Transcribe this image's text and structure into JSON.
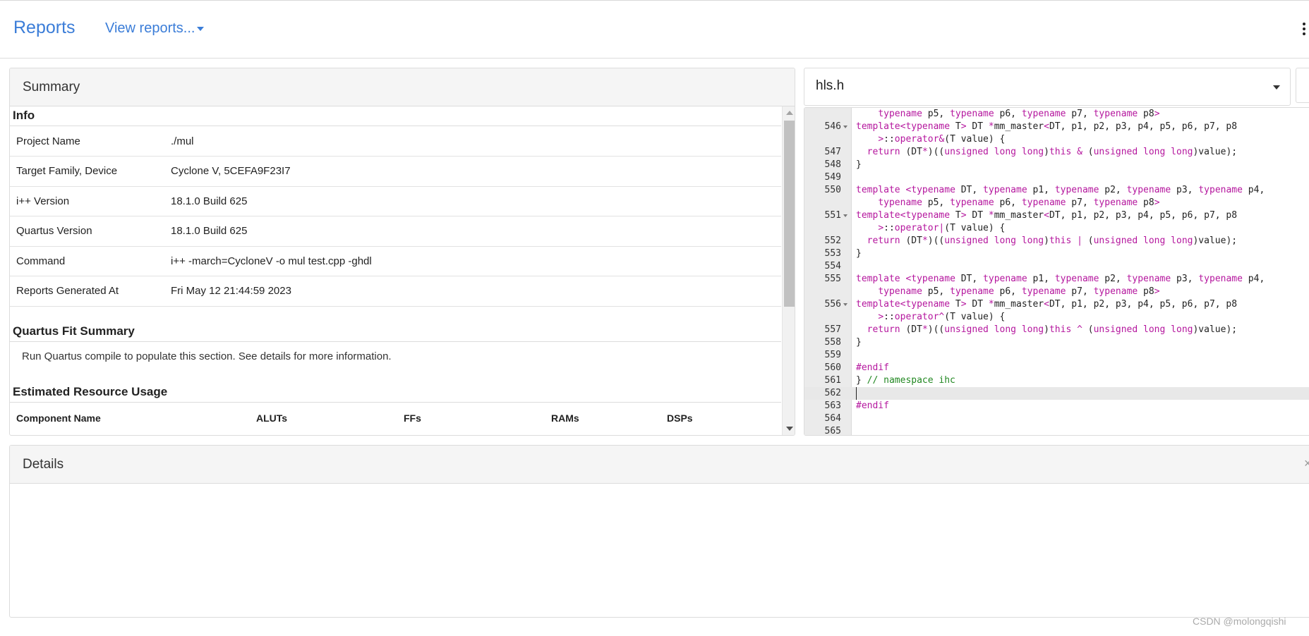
{
  "header": {
    "brand": "Reports",
    "view_reports": "View reports..."
  },
  "summary": {
    "title": "Summary",
    "info_title": "Info",
    "info_rows": [
      {
        "key": "Project Name",
        "value": "./mul"
      },
      {
        "key": "Target Family, Device",
        "value": "Cyclone V, 5CEFA9F23I7"
      },
      {
        "key": "i++ Version",
        "value": "18.1.0 Build 625"
      },
      {
        "key": "Quartus Version",
        "value": "18.1.0 Build 625"
      },
      {
        "key": "Command",
        "value": "i++ -march=CycloneV -o mul test.cpp -ghdl"
      },
      {
        "key": "Reports Generated At",
        "value": "Fri May 12 21:44:59 2023"
      }
    ],
    "fit_title": "Quartus Fit Summary",
    "fit_note": "Run Quartus compile to populate this section. See details for more information.",
    "resource_title": "Estimated Resource Usage",
    "resource_columns": [
      "Component Name",
      "ALUTs",
      "FFs",
      "RAMs",
      "DSPs"
    ]
  },
  "code": {
    "file": "hls.h",
    "lines": [
      {
        "num": "",
        "fold": false,
        "segs": [
          {
            "t": "    "
          },
          {
            "t": "typename",
            "k": 1
          },
          {
            "t": " p5, "
          },
          {
            "t": "typename",
            "k": 1
          },
          {
            "t": " p6, "
          },
          {
            "t": "typename",
            "k": 1
          },
          {
            "t": " p7, "
          },
          {
            "t": "typename",
            "k": 1
          },
          {
            "t": " p8"
          },
          {
            "t": ">",
            "k": 1
          }
        ]
      },
      {
        "num": "546",
        "fold": true,
        "segs": [
          {
            "t": "template<typename",
            "k": 1
          },
          {
            "t": " T"
          },
          {
            "t": ">",
            "k": 1
          },
          {
            "t": " DT "
          },
          {
            "t": "*",
            "k": 1
          },
          {
            "t": "mm_master"
          },
          {
            "t": "<",
            "k": 1
          },
          {
            "t": "DT, p1, p2, p3, p4, p5, p6, p7, p8"
          }
        ]
      },
      {
        "num": "",
        "fold": false,
        "segs": [
          {
            "t": "    "
          },
          {
            "t": ">",
            "k": 1
          },
          {
            "t": "::"
          },
          {
            "t": "operator&",
            "k": 1
          },
          {
            "t": "(T value) {"
          }
        ]
      },
      {
        "num": "547",
        "fold": false,
        "segs": [
          {
            "t": "  "
          },
          {
            "t": "return",
            "k": 1
          },
          {
            "t": " (DT"
          },
          {
            "t": "*",
            "k": 1
          },
          {
            "t": ")(("
          },
          {
            "t": "unsigned long long",
            "k": 1
          },
          {
            "t": ")"
          },
          {
            "t": "this",
            "k": 1
          },
          {
            "t": " "
          },
          {
            "t": "&",
            "k": 1
          },
          {
            "t": " ("
          },
          {
            "t": "unsigned long long",
            "k": 1
          },
          {
            "t": ")value);"
          }
        ]
      },
      {
        "num": "548",
        "fold": false,
        "segs": [
          {
            "t": "}"
          }
        ]
      },
      {
        "num": "549",
        "fold": false,
        "segs": []
      },
      {
        "num": "550",
        "fold": false,
        "segs": [
          {
            "t": "template",
            "k": 1
          },
          {
            "t": " "
          },
          {
            "t": "<typename",
            "k": 1
          },
          {
            "t": " DT, "
          },
          {
            "t": "typename",
            "k": 1
          },
          {
            "t": " p1, "
          },
          {
            "t": "typename",
            "k": 1
          },
          {
            "t": " p2, "
          },
          {
            "t": "typename",
            "k": 1
          },
          {
            "t": " p3, "
          },
          {
            "t": "typename",
            "k": 1
          },
          {
            "t": " p4,"
          }
        ]
      },
      {
        "num": "",
        "fold": false,
        "segs": [
          {
            "t": "    "
          },
          {
            "t": "typename",
            "k": 1
          },
          {
            "t": " p5, "
          },
          {
            "t": "typename",
            "k": 1
          },
          {
            "t": " p6, "
          },
          {
            "t": "typename",
            "k": 1
          },
          {
            "t": " p7, "
          },
          {
            "t": "typename",
            "k": 1
          },
          {
            "t": " p8"
          },
          {
            "t": ">",
            "k": 1
          }
        ]
      },
      {
        "num": "551",
        "fold": true,
        "segs": [
          {
            "t": "template<typename",
            "k": 1
          },
          {
            "t": " T"
          },
          {
            "t": ">",
            "k": 1
          },
          {
            "t": " DT "
          },
          {
            "t": "*",
            "k": 1
          },
          {
            "t": "mm_master"
          },
          {
            "t": "<",
            "k": 1
          },
          {
            "t": "DT, p1, p2, p3, p4, p5, p6, p7, p8"
          }
        ]
      },
      {
        "num": "",
        "fold": false,
        "segs": [
          {
            "t": "    "
          },
          {
            "t": ">",
            "k": 1
          },
          {
            "t": "::"
          },
          {
            "t": "operator|",
            "k": 1
          },
          {
            "t": "(T value) {"
          }
        ]
      },
      {
        "num": "552",
        "fold": false,
        "segs": [
          {
            "t": "  "
          },
          {
            "t": "return",
            "k": 1
          },
          {
            "t": " (DT"
          },
          {
            "t": "*",
            "k": 1
          },
          {
            "t": ")(("
          },
          {
            "t": "unsigned long long",
            "k": 1
          },
          {
            "t": ")"
          },
          {
            "t": "this",
            "k": 1
          },
          {
            "t": " "
          },
          {
            "t": "|",
            "k": 1
          },
          {
            "t": " ("
          },
          {
            "t": "unsigned long long",
            "k": 1
          },
          {
            "t": ")value);"
          }
        ]
      },
      {
        "num": "553",
        "fold": false,
        "segs": [
          {
            "t": "}"
          }
        ]
      },
      {
        "num": "554",
        "fold": false,
        "segs": []
      },
      {
        "num": "555",
        "fold": false,
        "segs": [
          {
            "t": "template",
            "k": 1
          },
          {
            "t": " "
          },
          {
            "t": "<typename",
            "k": 1
          },
          {
            "t": " DT, "
          },
          {
            "t": "typename",
            "k": 1
          },
          {
            "t": " p1, "
          },
          {
            "t": "typename",
            "k": 1
          },
          {
            "t": " p2, "
          },
          {
            "t": "typename",
            "k": 1
          },
          {
            "t": " p3, "
          },
          {
            "t": "typename",
            "k": 1
          },
          {
            "t": " p4,"
          }
        ]
      },
      {
        "num": "",
        "fold": false,
        "segs": [
          {
            "t": "    "
          },
          {
            "t": "typename",
            "k": 1
          },
          {
            "t": " p5, "
          },
          {
            "t": "typename",
            "k": 1
          },
          {
            "t": " p6, "
          },
          {
            "t": "typename",
            "k": 1
          },
          {
            "t": " p7, "
          },
          {
            "t": "typename",
            "k": 1
          },
          {
            "t": " p8"
          },
          {
            "t": ">",
            "k": 1
          }
        ]
      },
      {
        "num": "556",
        "fold": true,
        "segs": [
          {
            "t": "template<typename",
            "k": 1
          },
          {
            "t": " T"
          },
          {
            "t": ">",
            "k": 1
          },
          {
            "t": " DT "
          },
          {
            "t": "*",
            "k": 1
          },
          {
            "t": "mm_master"
          },
          {
            "t": "<",
            "k": 1
          },
          {
            "t": "DT, p1, p2, p3, p4, p5, p6, p7, p8"
          }
        ]
      },
      {
        "num": "",
        "fold": false,
        "segs": [
          {
            "t": "    "
          },
          {
            "t": ">",
            "k": 1
          },
          {
            "t": "::"
          },
          {
            "t": "operator^",
            "k": 1
          },
          {
            "t": "(T value) {"
          }
        ]
      },
      {
        "num": "557",
        "fold": false,
        "segs": [
          {
            "t": "  "
          },
          {
            "t": "return",
            "k": 1
          },
          {
            "t": " (DT"
          },
          {
            "t": "*",
            "k": 1
          },
          {
            "t": ")(("
          },
          {
            "t": "unsigned long long",
            "k": 1
          },
          {
            "t": ")"
          },
          {
            "t": "this",
            "k": 1
          },
          {
            "t": " "
          },
          {
            "t": "^",
            "k": 1
          },
          {
            "t": " ("
          },
          {
            "t": "unsigned long long",
            "k": 1
          },
          {
            "t": ")value);"
          }
        ]
      },
      {
        "num": "558",
        "fold": false,
        "segs": [
          {
            "t": "}"
          }
        ]
      },
      {
        "num": "559",
        "fold": false,
        "segs": []
      },
      {
        "num": "560",
        "fold": false,
        "segs": [
          {
            "t": "#endif",
            "k": 1
          }
        ]
      },
      {
        "num": "561",
        "fold": false,
        "segs": [
          {
            "t": "} "
          },
          {
            "t": "// namespace ihc",
            "c": 1
          }
        ]
      },
      {
        "num": "562",
        "fold": false,
        "active": true,
        "segs": []
      },
      {
        "num": "563",
        "fold": false,
        "segs": [
          {
            "t": "#endif",
            "k": 1
          }
        ]
      },
      {
        "num": "564",
        "fold": false,
        "segs": []
      },
      {
        "num": "565",
        "fold": false,
        "segs": []
      }
    ]
  },
  "details": {
    "title": "Details",
    "close": "×"
  },
  "watermark": "CSDN @molongqishi"
}
